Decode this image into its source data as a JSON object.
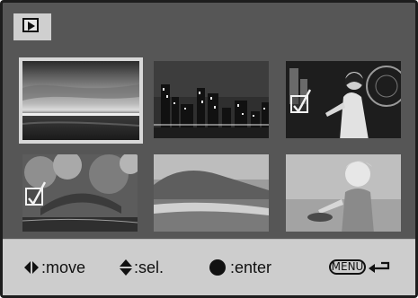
{
  "mode": {
    "icon": "playback-icon"
  },
  "thumbnails": [
    {
      "name": "seascape-thumbnail",
      "icon": "photo",
      "selected": true,
      "marked": false
    },
    {
      "name": "city-skyline-thumbnail",
      "icon": "photo",
      "selected": false,
      "marked": false
    },
    {
      "name": "woman-ferris-wheel-thumbnail",
      "icon": "photo",
      "selected": false,
      "marked": true
    },
    {
      "name": "bridge-park-thumbnail",
      "icon": "photo",
      "selected": false,
      "marked": true
    },
    {
      "name": "beach-hills-thumbnail",
      "icon": "photo",
      "selected": false,
      "marked": false
    },
    {
      "name": "child-on-beach-thumbnail",
      "icon": "photo",
      "selected": false,
      "marked": false
    }
  ],
  "footer": {
    "move_label": ":move",
    "select_label": ":sel.",
    "enter_label": ":enter",
    "menu_label": "MENU",
    "icons": [
      "left-right-arrows-icon",
      "up-down-arrows-icon",
      "enter-dot-icon",
      "menu-badge-icon",
      "return-arrow-icon"
    ]
  },
  "colors": {
    "screen_bg": "#565656",
    "footer_bg": "#cdcdcd",
    "selection_frame": "#d8d8d8"
  }
}
